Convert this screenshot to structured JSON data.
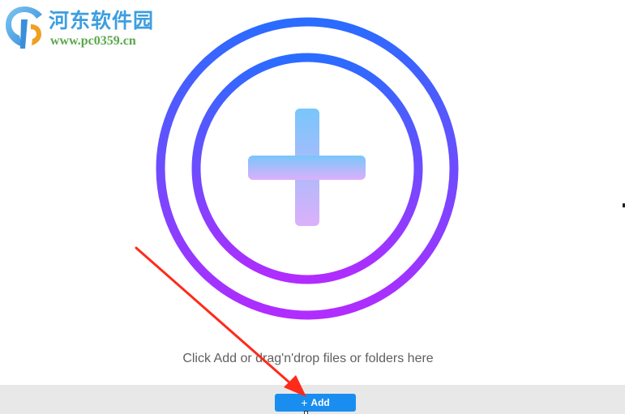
{
  "watermark": {
    "title": "河东软件园",
    "url": "www.pc0359.cn"
  },
  "drop_zone": {
    "hint": "Click Add or drag'n'drop files or folders here",
    "icon": "add-circle-icon"
  },
  "toolbar": {
    "add_label": "Add",
    "add_icon": "plus-icon"
  },
  "colors": {
    "ring_top": "#2a6cff",
    "ring_bottom": "#b12cff",
    "plus_top": "#78c6fb",
    "plus_bottom": "#dcb0fb",
    "button": "#1a8ef0",
    "toolbar_bg": "#e8e8e8",
    "arrow": "#ff2a1a"
  }
}
